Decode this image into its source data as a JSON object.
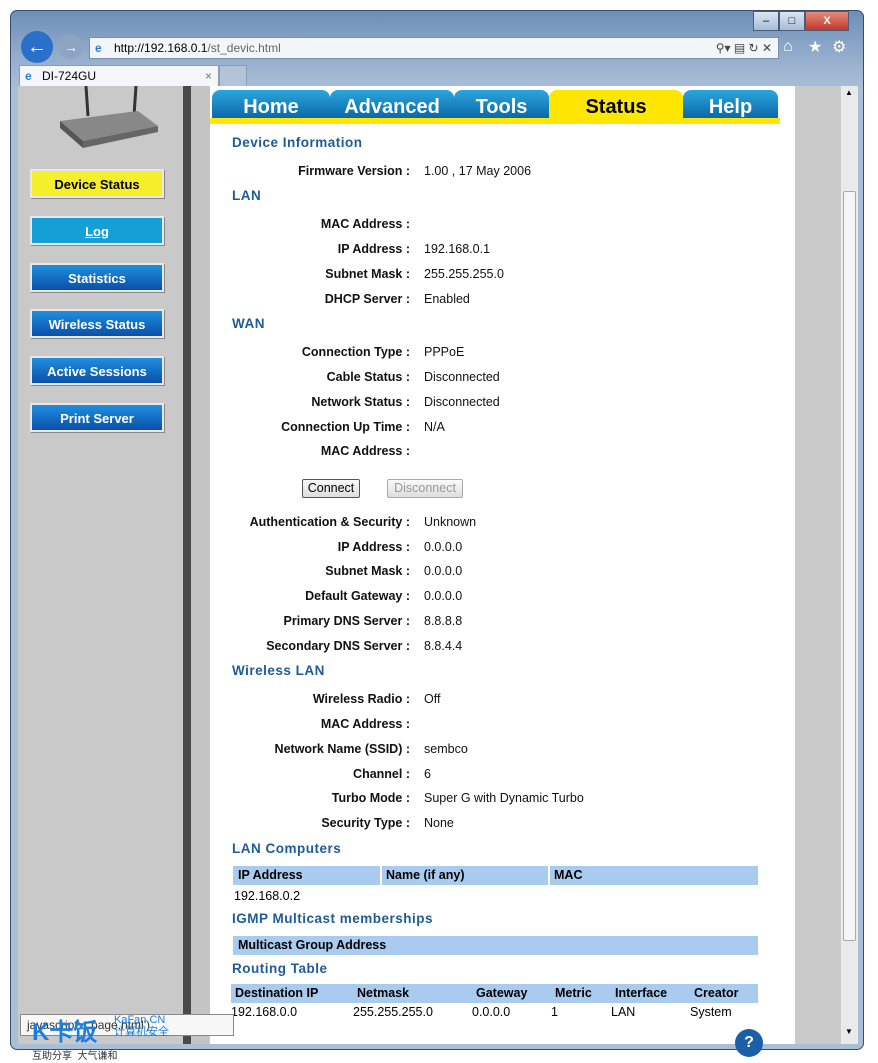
{
  "browser": {
    "url_host": "http://192.168.0.1",
    "url_path": "/st_devic.html",
    "tab_title": "DI-724GU",
    "tab_close": "×",
    "status_text": "javascript:...page.html')",
    "watermark_brand": "K卡饭",
    "watermark_site": "KaFan.CN",
    "watermark_sub": "计算机安全",
    "watermark_slogan": "互助分享  大气谦和"
  },
  "top_tabs": [
    {
      "label": "Home"
    },
    {
      "label": "Advanced"
    },
    {
      "label": "Tools"
    },
    {
      "label": "Status",
      "active": true
    },
    {
      "label": "Help"
    }
  ],
  "sidebar": [
    {
      "label": "Device Status",
      "active": true
    },
    {
      "label": "Log"
    },
    {
      "label": "Statistics"
    },
    {
      "label": "Wireless Status"
    },
    {
      "label": "Active Sessions"
    },
    {
      "label": "Print Server"
    }
  ],
  "sections": {
    "device": {
      "title": "Device Information",
      "firmware_label": "Firmware Version :",
      "firmware_value": "1.00 ,    17 May 2006"
    },
    "lan": {
      "title": "LAN",
      "rows": [
        {
          "label": "MAC Address :",
          "value": ""
        },
        {
          "label": "IP Address :",
          "value": "192.168.0.1"
        },
        {
          "label": "Subnet Mask :",
          "value": "255.255.255.0"
        },
        {
          "label": "DHCP Server :",
          "value": "Enabled"
        }
      ]
    },
    "wan": {
      "title": "WAN",
      "rows": [
        {
          "label": "Connection Type :",
          "value": "PPPoE"
        },
        {
          "label": "Cable Status :",
          "value": "Disconnected"
        },
        {
          "label": "Network Status :",
          "value": "Disconnected"
        },
        {
          "label": "Connection Up Time :",
          "value": "N/A"
        },
        {
          "label": "MAC Address :",
          "value": ""
        }
      ],
      "connect": "Connect",
      "disconnect": "Disconnect",
      "rows2": [
        {
          "label": "Authentication & Security :",
          "value": "Unknown"
        },
        {
          "label": "IP Address :",
          "value": "0.0.0.0"
        },
        {
          "label": "Subnet Mask :",
          "value": "0.0.0.0"
        },
        {
          "label": "Default Gateway :",
          "value": "0.0.0.0"
        },
        {
          "label": "Primary DNS Server :",
          "value": "8.8.8.8"
        },
        {
          "label": "Secondary DNS Server :",
          "value": "8.8.4.4"
        }
      ]
    },
    "wlan": {
      "title": "Wireless LAN",
      "rows": [
        {
          "label": "Wireless Radio :",
          "value": "Off"
        },
        {
          "label": "MAC Address :",
          "value": ""
        },
        {
          "label": "Network Name (SSID) :",
          "value": "sembco"
        },
        {
          "label": "Channel :",
          "value": "6"
        },
        {
          "label": "Turbo Mode :",
          "value": "Super G with Dynamic Turbo"
        },
        {
          "label": "Security Type :",
          "value": "None"
        }
      ]
    },
    "lan_computers": {
      "title": "LAN Computers",
      "headers": [
        "IP Address",
        "Name (if any)",
        "MAC"
      ],
      "rows": [
        [
          "192.168.0.2",
          "",
          ""
        ]
      ]
    },
    "igmp": {
      "title": "IGMP Multicast memberships",
      "headers": [
        "Multicast Group Address"
      ]
    },
    "routing": {
      "title": "Routing Table",
      "headers": [
        "Destination IP",
        "Netmask",
        "Gateway",
        "Metric",
        "Interface",
        "Creator"
      ],
      "rows": [
        [
          "192.168.0.0",
          "255.255.255.0",
          "0.0.0.0",
          "1",
          "LAN",
          "System"
        ]
      ]
    }
  }
}
